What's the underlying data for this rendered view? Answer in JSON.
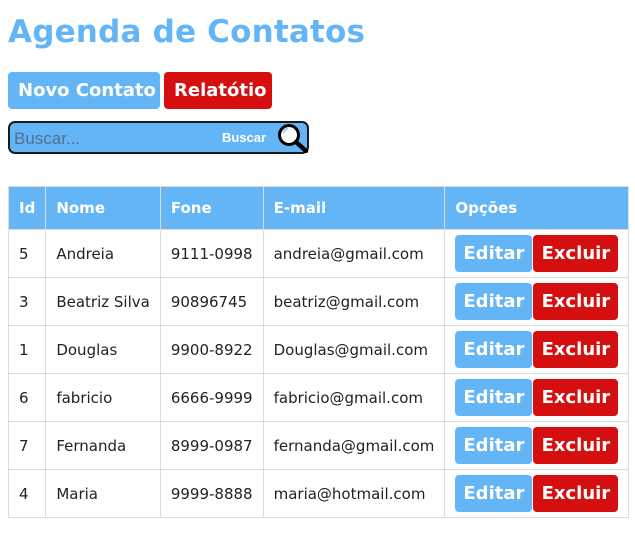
{
  "page": {
    "title": "Agenda de Contatos"
  },
  "toolbar": {
    "new_contact_label": "Novo Contato",
    "report_label": "Relatótio"
  },
  "search": {
    "placeholder": "Buscar...",
    "value": "",
    "button_label": "Buscar",
    "icon": "magnifier-icon"
  },
  "table": {
    "headers": {
      "id": "Id",
      "nome": "Nome",
      "fone": "Fone",
      "email": "E-mail",
      "opcoes": "Opções"
    },
    "edit_label": "Editar",
    "delete_label": "Excluir",
    "rows": [
      {
        "id": "5",
        "nome": "Andreia",
        "fone": "9111-0998",
        "email": "andreia@gmail.com"
      },
      {
        "id": "3",
        "nome": "Beatriz Silva",
        "fone": "90896745",
        "email": "beatriz@gmail.com"
      },
      {
        "id": "1",
        "nome": "Douglas",
        "fone": "9900-8922",
        "email": "Douglas@gmail.com"
      },
      {
        "id": "6",
        "nome": "fabricio",
        "fone": "6666-9999",
        "email": "fabricio@gmail.com"
      },
      {
        "id": "7",
        "nome": "Fernanda",
        "fone": "8999-0987",
        "email": "fernanda@gmail.com"
      },
      {
        "id": "4",
        "nome": "Maria",
        "fone": "9999-8888",
        "email": "maria@hotmail.com"
      }
    ]
  },
  "colors": {
    "accent": "#64b5f6",
    "danger": "#d50f0f"
  }
}
